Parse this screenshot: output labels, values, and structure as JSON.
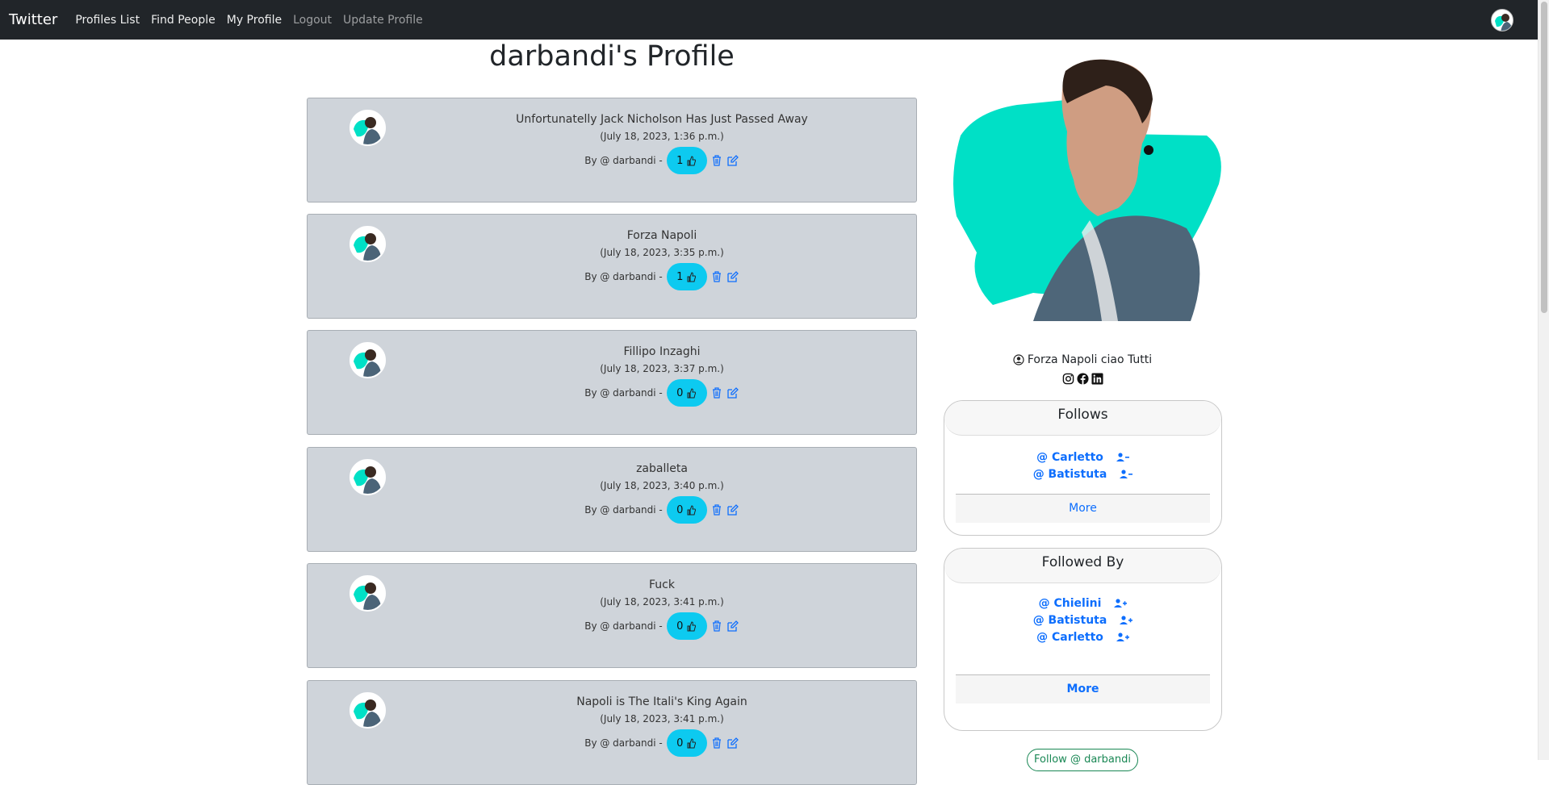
{
  "nav": {
    "brand": "Twitter",
    "links": [
      "Profiles List",
      "Find People",
      "My Profile",
      "Logout",
      "Update Profile"
    ]
  },
  "page": {
    "title": "darbandi's Profile"
  },
  "posts": [
    {
      "title": "Unfortunatelly Jack Nicholson Has Just Passed Away",
      "date": "(July 18, 2023, 1:36 p.m.)",
      "by": "By @ darbandi -",
      "likes": "1"
    },
    {
      "title": "Forza Napoli",
      "date": "(July 18, 2023, 3:35 p.m.)",
      "by": "By @ darbandi -",
      "likes": "1"
    },
    {
      "title": "Fillipo Inzaghi",
      "date": "(July 18, 2023, 3:37 p.m.)",
      "by": "By @ darbandi -",
      "likes": "0"
    },
    {
      "title": "zaballeta",
      "date": "(July 18, 2023, 3:40 p.m.)",
      "by": "By @ darbandi -",
      "likes": "0"
    },
    {
      "title": "Fuck",
      "date": "(July 18, 2023, 3:41 p.m.)",
      "by": "By @ darbandi -",
      "likes": "0"
    },
    {
      "title": "Napoli is The Itali's King Again",
      "date": "(July 18, 2023, 3:41 p.m.)",
      "by": "By @ darbandi -",
      "likes": "0"
    }
  ],
  "profile": {
    "bio": "Forza Napoli ciao Tutti",
    "socials": [
      "instagram-icon",
      "facebook-icon",
      "linkedin-icon"
    ]
  },
  "follows": {
    "title": "Follows",
    "users": [
      "@ Carletto",
      "@ Batistuta"
    ],
    "more": "More"
  },
  "followed_by": {
    "title": "Followed By",
    "users": [
      "@ Chielini",
      "@ Batistuta",
      "@ Carletto"
    ],
    "more": "More"
  },
  "follow_button": "Follow @ darbandi",
  "colors": {
    "navbar": "#212529",
    "card_bg": "#cfd4da",
    "like_bg": "#0dcaf0",
    "link": "#0d6efd"
  }
}
